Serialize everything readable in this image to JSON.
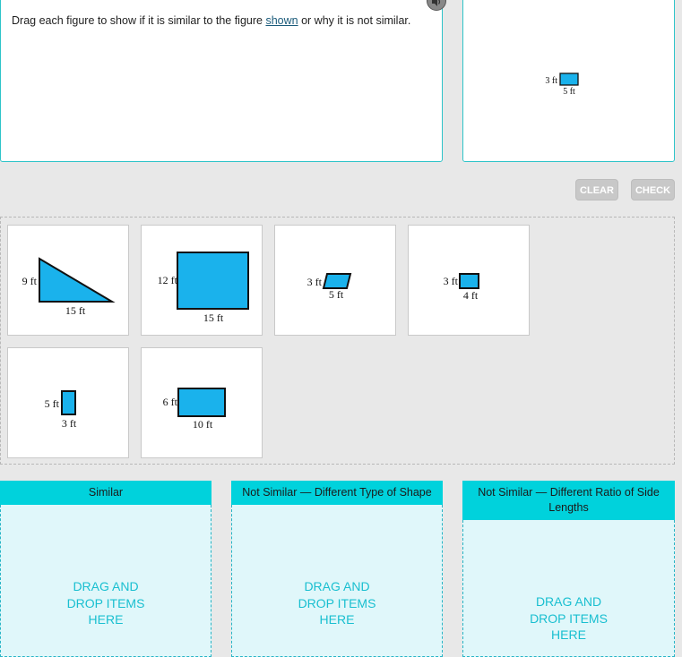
{
  "prompt": {
    "text_before": "Drag each figure to show if it is similar to the figure ",
    "link": "shown",
    "text_after": " or why it is not similar."
  },
  "reference_figure": {
    "side_label": "3 ft",
    "bottom_label": "5 ft"
  },
  "buttons": {
    "clear": "CLEAR",
    "check": "CHECK"
  },
  "cards": [
    {
      "shape": "right-triangle",
      "side_label": "9 ft",
      "bottom_label": "15 ft"
    },
    {
      "shape": "rectangle",
      "side_label": "12 ft",
      "bottom_label": "15 ft"
    },
    {
      "shape": "parallelogram",
      "side_label": "3 ft",
      "bottom_label": "5 ft"
    },
    {
      "shape": "rectangle",
      "side_label": "3 ft",
      "bottom_label": "4 ft"
    },
    {
      "shape": "rectangle",
      "side_label": "5 ft",
      "bottom_label": "3 ft"
    },
    {
      "shape": "rectangle",
      "side_label": "6 ft",
      "bottom_label": "10 ft"
    }
  ],
  "drop_zones": [
    {
      "title": "Similar",
      "hint": [
        "DRAG AND",
        "DROP ITEMS",
        "HERE"
      ]
    },
    {
      "title": "Not Similar — Different Type of Shape",
      "hint": [
        "DRAG AND",
        "DROP ITEMS",
        "HERE"
      ]
    },
    {
      "title": "Not Similar — Different Ratio of Side Lengths",
      "hint": [
        "DRAG AND",
        "DROP ITEMS",
        "HERE"
      ]
    }
  ],
  "colors": {
    "shape_fill": "#1ab2ec",
    "accent": "#00d2dc",
    "zone_bg": "#e0f7fa"
  }
}
